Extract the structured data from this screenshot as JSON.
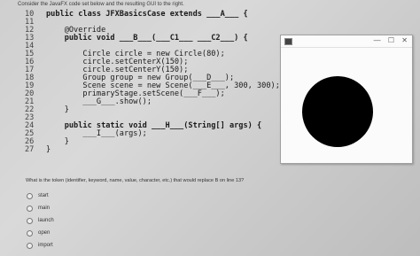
{
  "header": {
    "instruction": "Consider the JavaFX code set below and the resulting GUI to the right."
  },
  "code_lines": [
    {
      "num": "10",
      "text": "public class JFXBasicsCase extends ___A___ {"
    },
    {
      "num": "11",
      "text": ""
    },
    {
      "num": "12",
      "text": "    @Override"
    },
    {
      "num": "13",
      "text": "    public void ___B___(___C1___ ___C2___) {"
    },
    {
      "num": "14",
      "text": ""
    },
    {
      "num": "15",
      "text": "        Circle circle = new Circle(80);"
    },
    {
      "num": "16",
      "text": "        circle.setCenterX(150);"
    },
    {
      "num": "17",
      "text": "        circle.setCenterY(150);"
    },
    {
      "num": "18",
      "text": "        Group group = new Group(___D___);"
    },
    {
      "num": "19",
      "text": "        Scene scene = new Scene(___E___, 300, 300);"
    },
    {
      "num": "20",
      "text": "        primaryStage.setScene(___F___);"
    },
    {
      "num": "21",
      "text": "        ___G___.show();"
    },
    {
      "num": "22",
      "text": "    }"
    },
    {
      "num": "23",
      "text": ""
    },
    {
      "num": "24",
      "text": "    public static void ___H___(String[] args) {"
    },
    {
      "num": "25",
      "text": "        ___I___(args);"
    },
    {
      "num": "26",
      "text": "    }"
    },
    {
      "num": "27",
      "text": "}"
    }
  ],
  "window": {
    "controls": [
      "—",
      "☐",
      "✕"
    ]
  },
  "question": {
    "text": "What is the token (identifier, keyword, name, value, character, etc.) that would replace B on line 13?"
  },
  "options": [
    "start",
    "main",
    "launch",
    "open",
    "import"
  ]
}
